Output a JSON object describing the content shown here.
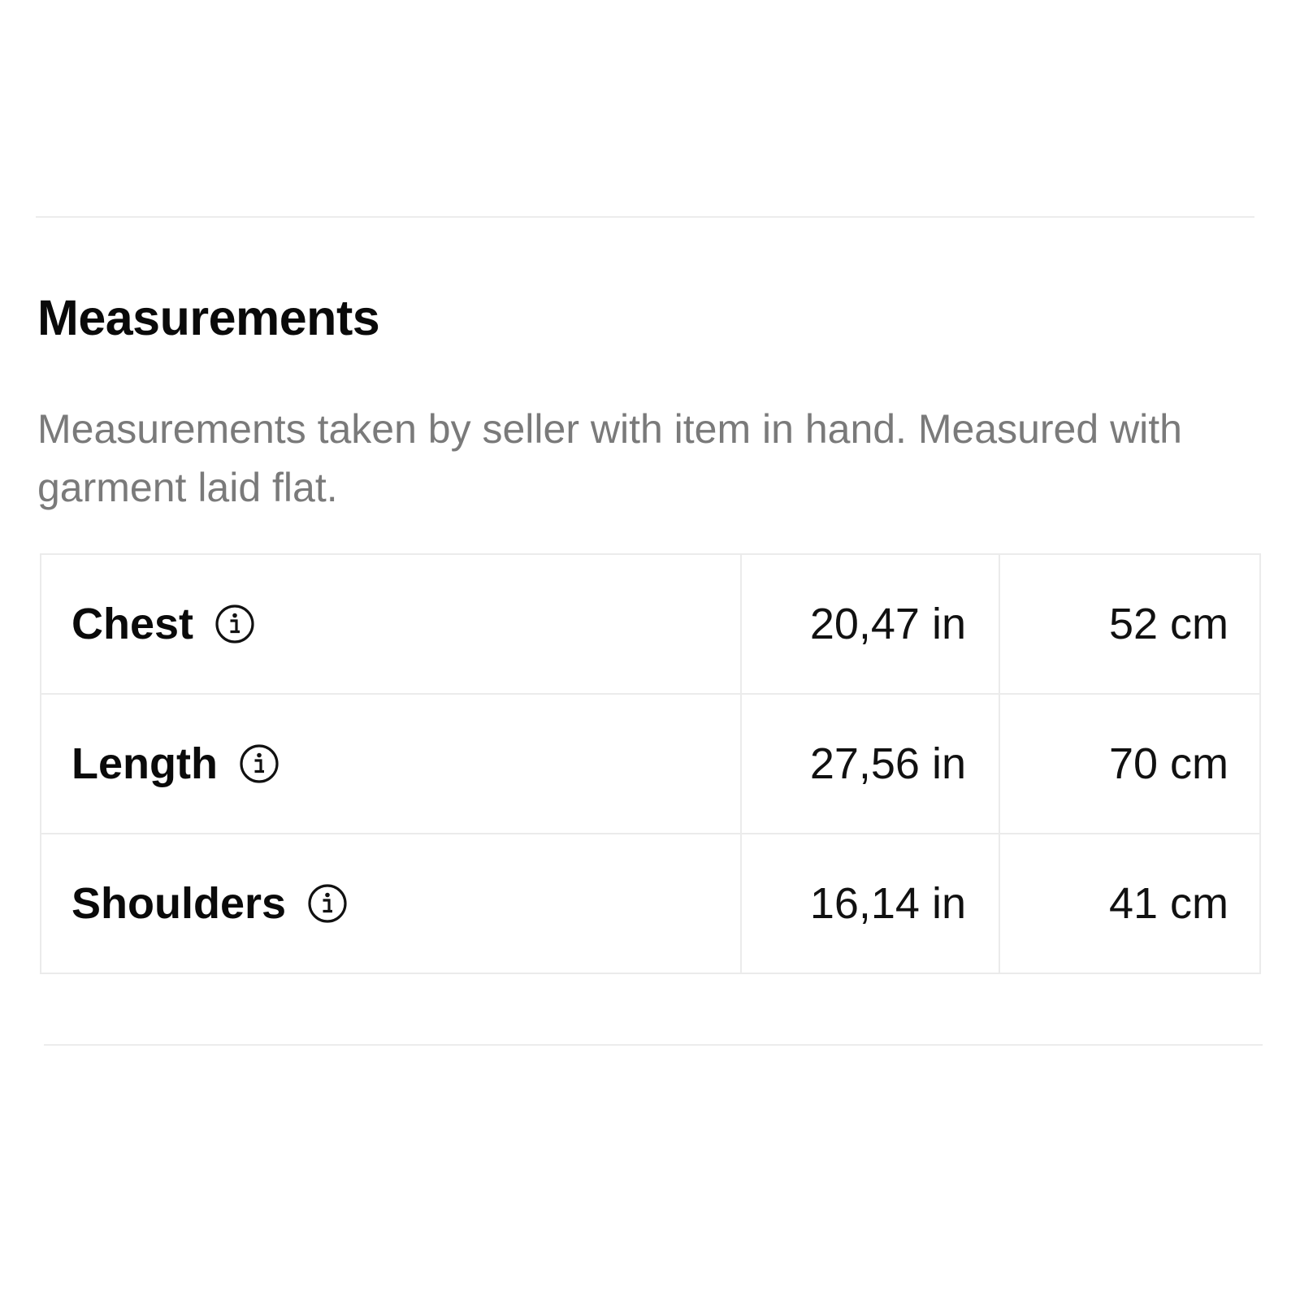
{
  "section": {
    "title": "Measurements",
    "description": "Measurements taken by seller with item in hand. Measured with garment laid flat."
  },
  "measurements": [
    {
      "label": "Chest",
      "inches": "20,47 in",
      "centimeters": "52 cm",
      "icon": "info-icon"
    },
    {
      "label": "Length",
      "inches": "27,56 in",
      "centimeters": "70 cm",
      "icon": "info-icon"
    },
    {
      "label": "Shoulders",
      "inches": "16,14 in",
      "centimeters": "41 cm",
      "icon": "info-icon"
    }
  ],
  "colors": {
    "text": "#0a0a0a",
    "description": "#7a7a7a",
    "border": "#ebebeb"
  }
}
